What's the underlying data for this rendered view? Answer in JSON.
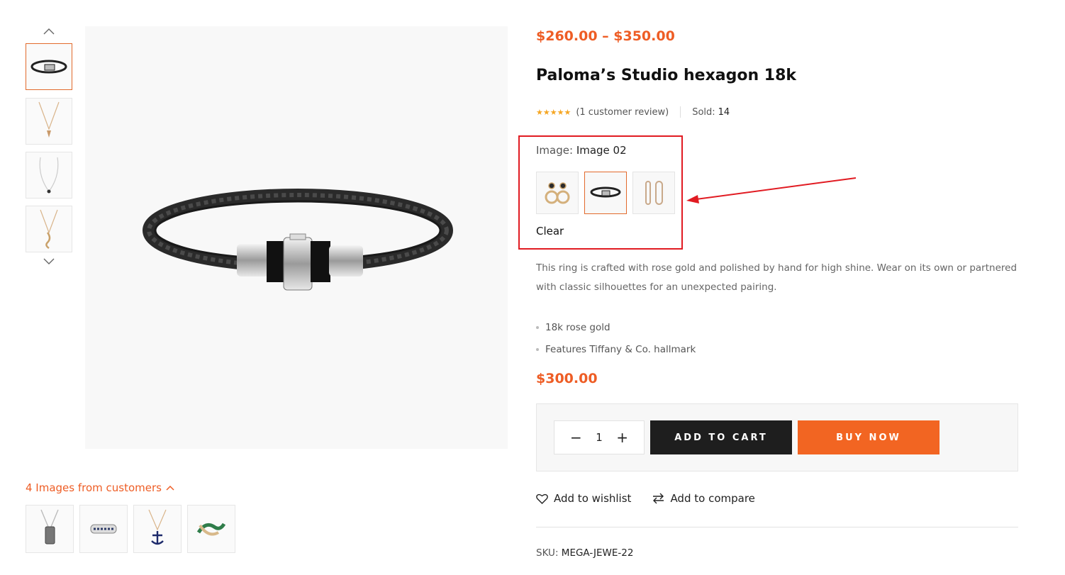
{
  "gallery": {
    "thumbnails": [
      {
        "icon": "bracelet-thumb-icon",
        "active": true
      },
      {
        "icon": "necklace-thumb-icon",
        "active": false
      },
      {
        "icon": "pendant-thumb-icon",
        "active": false
      },
      {
        "icon": "chain-thumb-icon",
        "active": false
      }
    ],
    "main_image_icon": "leather-bracelet-image"
  },
  "product": {
    "price_range": "$260.00 – $350.00",
    "title": "Paloma’s Studio hexagon 18k",
    "stars": "★★★★★",
    "review_text": "(1 customer review)",
    "sold_label": "Sold:",
    "sold_value": "14",
    "variation": {
      "label": "Image:",
      "value": "Image 02",
      "options": [
        "earrings-swatch-icon",
        "bracelet-swatch-icon",
        "hoops-swatch-icon"
      ],
      "selected_index": 1,
      "clear_label": "Clear"
    },
    "description": "This ring is crafted with rose gold and polished by hand for high shine. Wear on its own or partnered with classic silhouettes for an unexpected pairing.",
    "features": [
      "18k rose gold",
      "Features Tiffany & Co. hallmark"
    ],
    "variation_price": "$300.00",
    "quantity": "1",
    "add_to_cart_label": "ADD TO CART",
    "buy_now_label": "BUY NOW",
    "wishlist_label": "Add to wishlist",
    "compare_label": "Add to compare",
    "sku_label": "SKU:",
    "sku_value": "MEGA-JEWE-22"
  },
  "customers": {
    "link_text": "4 Images from customers",
    "thumbnails": [
      "tag-necklace-icon",
      "ring-icon",
      "anchor-necklace-icon",
      "green-ring-icon"
    ]
  },
  "colors": {
    "accent": "#ee5d25",
    "highlight": "#e11b22",
    "dark": "#1e1e1e"
  }
}
